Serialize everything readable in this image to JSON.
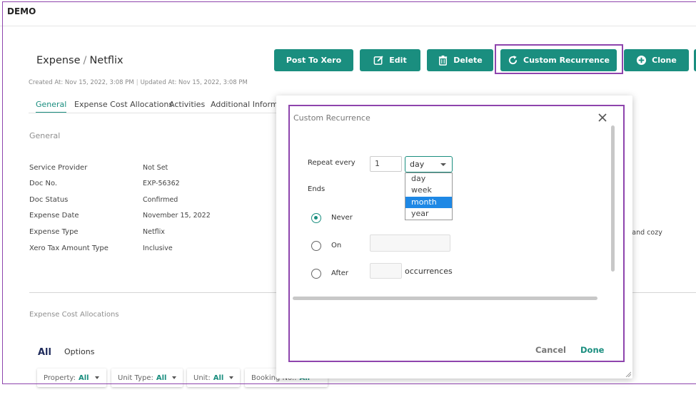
{
  "app": {
    "brand": "DEMO"
  },
  "page": {
    "title_main": "Expense",
    "title_sep": "/",
    "title_sub": "Netflix",
    "created_at": "Created At: Nov 15, 2022, 3:08 PM",
    "updated_at": "Updated At: Nov 15, 2022, 3:08 PM"
  },
  "toolbar": {
    "post_to_xero": "Post To Xero",
    "edit": "Edit",
    "delete": "Delete",
    "custom_recurrence": "Custom Recurrence",
    "clone": "Clone"
  },
  "tabs": [
    "General",
    "Expense Cost Allocations",
    "Activities",
    "Additional Informat"
  ],
  "general": {
    "section_title": "General",
    "fields": [
      {
        "label": "Service Provider",
        "value": "Not Set"
      },
      {
        "label": "Doc No.",
        "value": "EXP-56362"
      },
      {
        "label": "Doc Status",
        "value": "Confirmed"
      },
      {
        "label": "Expense Date",
        "value": "November 15, 2022"
      },
      {
        "label": "Expense Type",
        "value": "Netflix"
      },
      {
        "label": "Xero Tax Amount Type",
        "value": "Inclusive"
      }
    ],
    "right_snippet": "m and cozy"
  },
  "allocations": {
    "section_title": "Expense Cost Allocations",
    "tab_all": "All",
    "tab_options": "Options",
    "filters": [
      {
        "label": "Property:",
        "value": "All"
      },
      {
        "label": "Unit Type:",
        "value": "All"
      },
      {
        "label": "Unit:",
        "value": "All"
      },
      {
        "label": "Booking No.:",
        "value": "All"
      }
    ]
  },
  "modal": {
    "title": "Custom Recurrence",
    "repeat_every_label": "Repeat every",
    "repeat_value": "1",
    "period_selected": "day",
    "period_options": [
      "day",
      "week",
      "month",
      "year"
    ],
    "period_highlighted": "month",
    "ends_label": "Ends",
    "end_options": [
      {
        "label": "Never",
        "checked": true
      },
      {
        "label": "On",
        "checked": false
      },
      {
        "label": "After",
        "checked": false
      }
    ],
    "occurrences_label": "occurrences",
    "cancel": "Cancel",
    "done": "Done"
  },
  "colors": {
    "accent": "#1a8e7f",
    "highlight_frame": "#8e44ad",
    "dropdown_selected": "#1e88e5"
  }
}
